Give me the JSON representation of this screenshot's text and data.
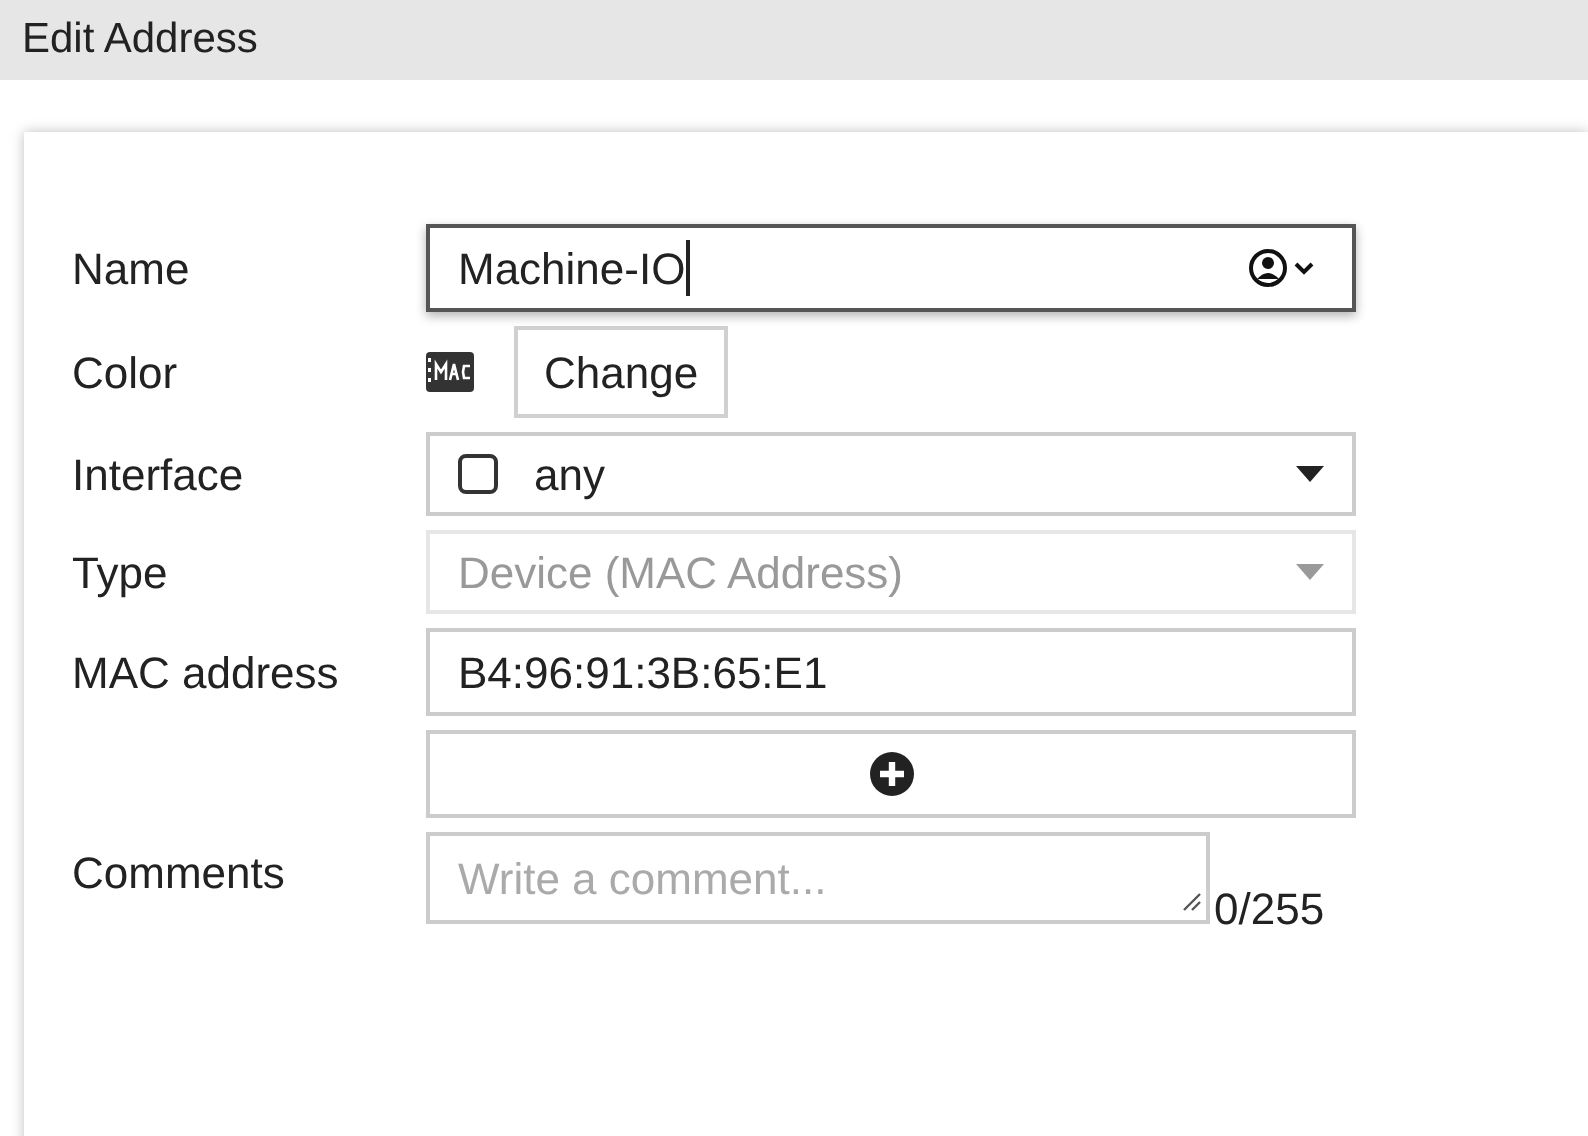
{
  "window": {
    "title": "Edit Address"
  },
  "fields": [
    {
      "kind": "name",
      "label": "Name",
      "value": "Machine-IO",
      "focused": true
    },
    {
      "kind": "color",
      "label": "Color",
      "button": "Change"
    },
    {
      "kind": "select",
      "label": "Interface",
      "value": "any",
      "checked": false,
      "disabled": false
    },
    {
      "kind": "select",
      "label": "Type",
      "value": "Device (MAC Address)",
      "disabled": true
    },
    {
      "kind": "text",
      "label": "MAC address",
      "value": "B4:96:91:3B:65:E1"
    },
    {
      "kind": "add"
    },
    {
      "kind": "comment",
      "label": "Comments",
      "placeholder": "Write a comment...",
      "counter": "0/255"
    }
  ]
}
